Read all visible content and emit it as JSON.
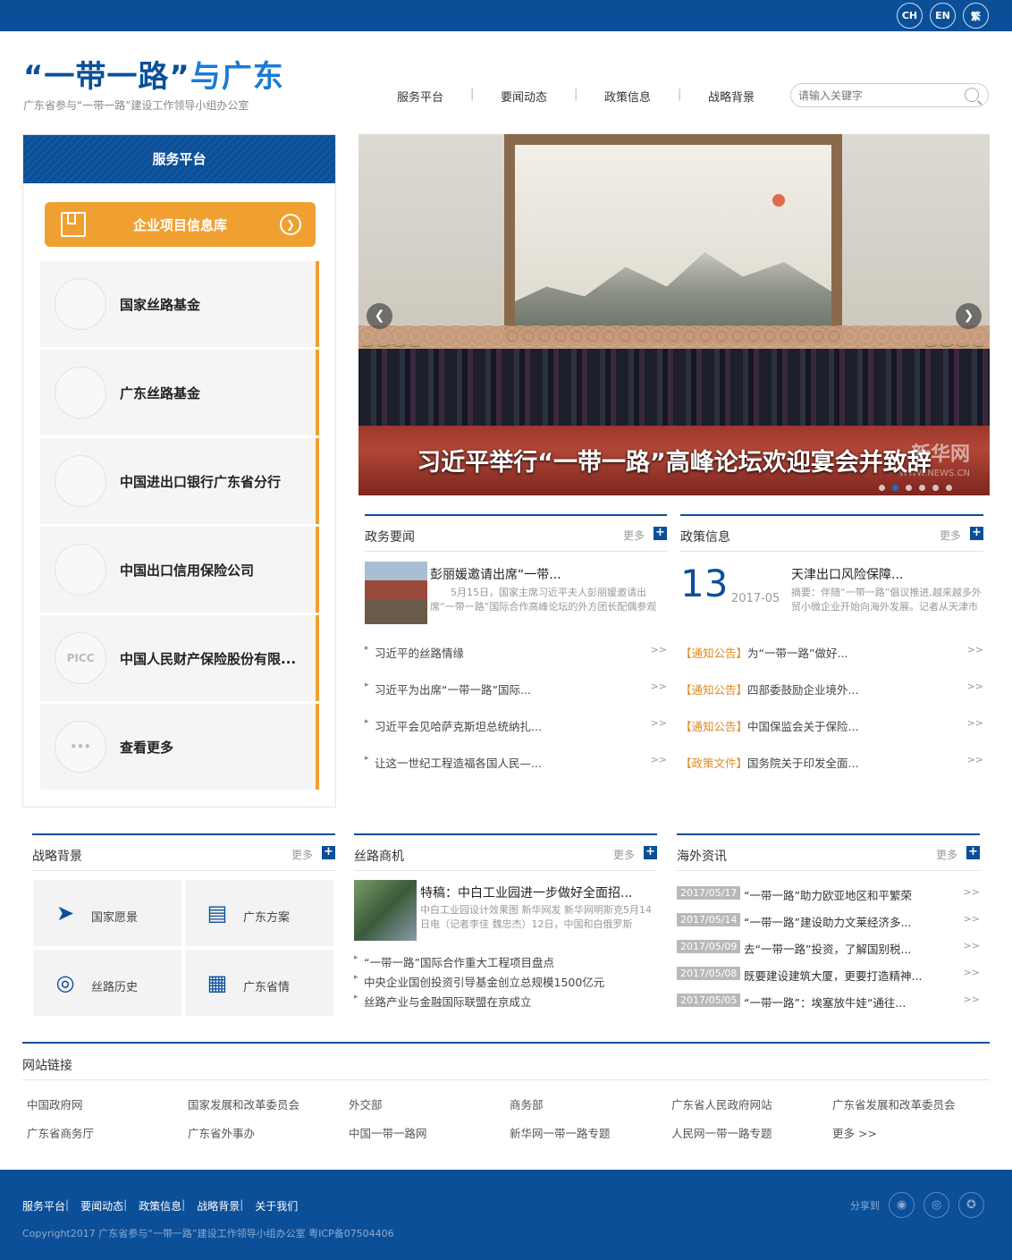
{
  "langs": [
    "CH",
    "EN",
    "繁"
  ],
  "logo": {
    "q1": "“",
    "title_a": "一带一路",
    "q2": "”",
    "title_b": "与广东",
    "subtitle": "广东省参与“一带一路”建设工作领导小组办公室"
  },
  "nav": [
    "服务平台",
    "要闻动态",
    "政策信息",
    "战略背景"
  ],
  "search": {
    "placeholder": "请输入关键字"
  },
  "service": {
    "header": "服务平台",
    "main_button": "企业项目信息库",
    "items": [
      "国家丝路基金",
      "广东丝路基金",
      "中国进出口银行广东省分行",
      "中国出口信用保险公司",
      "中国人民财产保险股份有限...",
      "查看更多"
    ],
    "icon_text": [
      "",
      "",
      "",
      "",
      "PICC",
      "•••"
    ]
  },
  "carousel": {
    "caption": "习近平举行“一带一路”高峰论坛欢迎宴会并致辞",
    "watermark": "新华网",
    "watermark_url": "WWW.NEWS.CN",
    "slides": 6,
    "active": 2
  },
  "zwyw": {
    "title": "政务要闻",
    "more": "更多",
    "feature_title": "彭丽媛邀请出席“一带...",
    "feature_desc": "5月15日，国家主席习近平夫人彭丽媛邀请出席“一带一路”国际合作高峰论坛的外方团长配偶参观",
    "items": [
      "习近平的丝路情缘",
      "习近平为出席“一带一路”国际...",
      "习近平会见哈萨克斯坦总统纳扎...",
      "让这一世纪工程造福各国人民—..."
    ]
  },
  "zcxx": {
    "title": "政策信息",
    "more": "更多",
    "day": "13",
    "date": "2017-05",
    "feature_title": "天津出口风险保障...",
    "feature_desc": "摘要：伴随“一带一路”倡议推进,越来越多外贸小微企业开始向海外发展。记者从天津市",
    "items": [
      {
        "tag": "【通知公告】",
        "text": "为“一带一路”做好..."
      },
      {
        "tag": "【通知公告】",
        "text": "四部委鼓励企业境外..."
      },
      {
        "tag": "【通知公告】",
        "text": "中国保监会关于保险..."
      },
      {
        "tag": "【政策文件】",
        "text": "国务院关于印发全面..."
      }
    ]
  },
  "zlbj": {
    "title": "战略背景",
    "more": "更多",
    "tiles": [
      "国家愿景",
      "广东方案",
      "丝路历史",
      "广东省情"
    ]
  },
  "slsj": {
    "title": "丝路商机",
    "more": "更多",
    "feature_title": "特稿：中白工业园进一步做好全面招...",
    "feature_desc": "中白工业园设计效果图 新华网发      新华网明斯克5月14日电（记者李佳 魏忠杰）12日，中国和白俄罗斯",
    "items": [
      "“一带一路”国际合作重大工程项目盘点",
      "中央企业国创投资引导基金创立总规模1500亿元",
      "丝路产业与金融国际联盟在京成立"
    ]
  },
  "hwzx": {
    "title": "海外资讯",
    "more": "更多",
    "items": [
      {
        "date": "2017/05/17",
        "text": "“一带一路”助力欧亚地区和平繁荣"
      },
      {
        "date": "2017/05/14",
        "text": "“一带一路”建设助力文莱经济多..."
      },
      {
        "date": "2017/05/09",
        "text": "去“一带一路”投资，了解国别税..."
      },
      {
        "date": "2017/05/08",
        "text": "既要建设建筑大厦，更要打造精神..."
      },
      {
        "date": "2017/05/05",
        "text": "“一带一路”：埃塞放牛娃“通往..."
      }
    ]
  },
  "links": {
    "title": "网站链接",
    "row1": [
      "中国政府网",
      "国家发展和改革委员会",
      "外交部",
      "商务部",
      "广东省人民政府网站",
      "广东省发展和改革委员会"
    ],
    "row2": [
      "广东省商务厅",
      "广东省外事办",
      "中国一带一路网",
      "新华网一带一路专题",
      "人民网一带一路专题",
      "更多 >>"
    ]
  },
  "footer": {
    "nav": [
      "服务平台",
      "要闻动态",
      "政策信息",
      "战略背景",
      "关于我们"
    ],
    "copyright": "Copyright2017 广东省参与“一带一路”建设工作领导小组办公室 粤ICP备07504406",
    "share": "分享到"
  },
  "arrow": ">>",
  "colors": {
    "brand": "#0b4f99",
    "accent": "#f0a030",
    "tag": "#e08a22"
  }
}
